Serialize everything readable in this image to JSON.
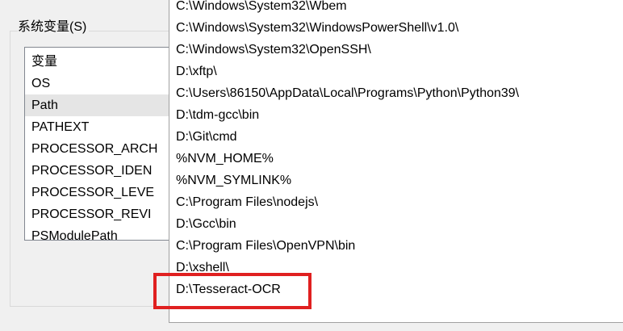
{
  "system_vars": {
    "group_label": "系统变量(S)",
    "header": "变量",
    "rows": [
      "OS",
      "Path",
      "PATHEXT",
      "PROCESSOR_ARCH",
      "PROCESSOR_IDEN",
      "PROCESSOR_LEVE",
      "PROCESSOR_REVI",
      "PSModulePath"
    ],
    "selected": "Path"
  },
  "path_editor": {
    "entries": [
      "C:\\Windows\\System32\\Wbem",
      "C:\\Windows\\System32\\WindowsPowerShell\\v1.0\\",
      "C:\\Windows\\System32\\OpenSSH\\",
      "D:\\xftp\\",
      "C:\\Users\\86150\\AppData\\Local\\Programs\\Python\\Python39\\",
      "D:\\tdm-gcc\\bin",
      "D:\\Git\\cmd",
      "%NVM_HOME%",
      "%NVM_SYMLINK%",
      "C:\\Program Files\\nodejs\\",
      "D:\\Gcc\\bin",
      "C:\\Program Files\\OpenVPN\\bin",
      "D:\\xshell\\",
      "D:\\Tesseract-OCR"
    ],
    "highlighted": "D:\\Tesseract-OCR"
  },
  "colors": {
    "highlight_border": "#e02020",
    "selected_row": "#e5e5e5"
  }
}
